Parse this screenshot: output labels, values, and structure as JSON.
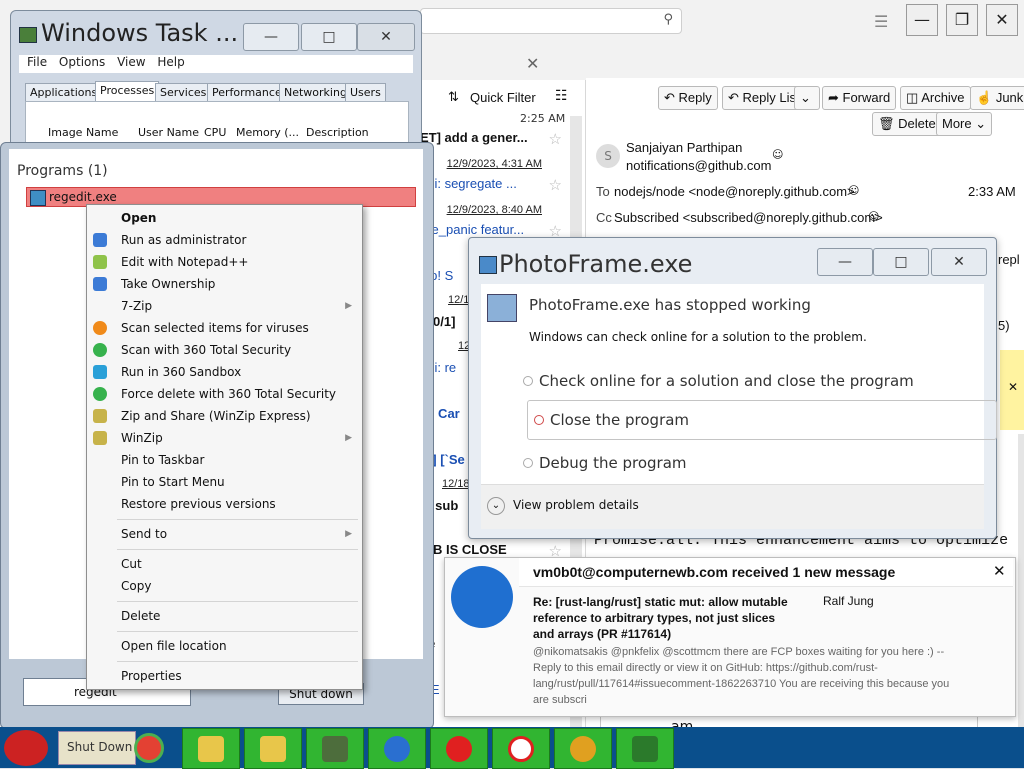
{
  "thunderbird": {
    "search_icon": "magnifier-icon",
    "time_partial": "2:25 AM",
    "quick_filter": "Quick Filter",
    "threads": [
      {
        "subject": "ET] add a gener...",
        "date": ""
      },
      {
        "subject": "",
        "date": "12/9/2023, 4:31 AM"
      },
      {
        "subject": "api: segregate ...",
        "date": ""
      },
      {
        "subject": "",
        "date": "12/9/2023, 8:40 AM"
      },
      {
        "subject": "ore_panic featur...",
        "date": ""
      },
      {
        "subject": "elp! S",
        "date": ""
      },
      {
        "subject": "",
        "date": "12/1"
      },
      {
        "subject": "H 0/1]",
        "date": ""
      },
      {
        "subject": "",
        "date": "12"
      },
      {
        "subject": "api: re",
        "date": ""
      },
      {
        "subject": "w] Car",
        "date": ""
      },
      {
        "subject": "rs] [`Se",
        "date": ""
      },
      {
        "subject": "",
        "date": "12/18"
      },
      {
        "subject": "id sub",
        "date": ""
      },
      {
        "subject": "N/B IS CLOSE",
        "date": ""
      },
      {
        "subject": "ro",
        "date": ""
      },
      {
        "subject": "de",
        "date": ""
      },
      {
        "subject": "e E",
        "date": ""
      }
    ],
    "buttons": {
      "reply": "Reply",
      "reply_list": "Reply List",
      "forward": "Forward",
      "archive": "Archive",
      "junk": "Junk",
      "delete": "Delete",
      "more": "More"
    },
    "sender_name": "Sanjaiyan Parthipan",
    "sender_email": "notifications@github.com",
    "to_label": "To",
    "to_value": "nodejs/node <node@noreply.github.com>",
    "time": "2:33 AM",
    "cc_label": "Cc",
    "cc_value": "Subscribed <subscribed@noreply.github.com>",
    "body_partial": "Promise.all. This enhancement aims to optimize the",
    "partial_right_1": "repl",
    "partial_right_2": "5)",
    "compose_placeholder": "am"
  },
  "task_manager": {
    "title": "Windows Task ...",
    "menu": [
      "File",
      "Options",
      "View",
      "Help"
    ],
    "tabs": [
      "Applications",
      "Processes",
      "Services",
      "Performance",
      "Networking",
      "Users"
    ],
    "active_tab": "Processes",
    "columns": [
      "Image Name",
      "User Name",
      "CPU",
      "Memory (...",
      "Description"
    ]
  },
  "start_menu": {
    "heading": "Programs (1)",
    "item": "regedit.exe",
    "search_value": "regedit",
    "shutdown": "Shut down"
  },
  "context_menu": {
    "items": [
      {
        "label": "Open",
        "bold": true
      },
      {
        "label": "Run as administrator",
        "icon": "shield-icon"
      },
      {
        "label": "Edit with Notepad++",
        "icon": "notepad-icon"
      },
      {
        "label": "Take Ownership",
        "icon": "shield-icon"
      },
      {
        "label": "7-Zip",
        "submenu": true
      },
      {
        "label": "Scan selected items for viruses",
        "icon": "antivirus-icon"
      },
      {
        "label": "Scan with 360 Total Security",
        "icon": "360-icon"
      },
      {
        "label": "Run in 360 Sandbox",
        "icon": "sandbox-icon"
      },
      {
        "label": "Force delete with 360 Total Security",
        "icon": "360-icon"
      },
      {
        "label": "Zip and Share (WinZip Express)",
        "icon": "winzip-icon"
      },
      {
        "label": "WinZip",
        "icon": "winzip-icon",
        "submenu": true
      },
      {
        "label": "Pin to Taskbar"
      },
      {
        "label": "Pin to Start Menu"
      },
      {
        "label": "Restore previous versions"
      },
      {
        "label": "Send to",
        "submenu": true
      },
      {
        "label": "Cut"
      },
      {
        "label": "Copy"
      },
      {
        "label": "Delete"
      },
      {
        "label": "Open file location"
      },
      {
        "label": "Properties"
      }
    ]
  },
  "photoframe": {
    "title": "PhotoFrame.exe",
    "heading": "PhotoFrame.exe has stopped working",
    "description": "Windows can check online for a solution to the problem.",
    "options": [
      "Check online for a solution and close the program",
      "Close the program",
      "Debug the program"
    ],
    "details": "View problem details"
  },
  "notification": {
    "title": "vm0b0t@computernewb.com received 1 new message",
    "subject": "Re: [rust-lang/rust] static mut: allow mutable reference to arbitrary types, not just slices and arrays (PR #117614)",
    "author": "Ralf Jung",
    "preview": "@nikomatsakis @pnkfelix @scottmcm there are FCP boxes waiting for you here :) -- Reply to this email directly or view it on GitHub: https://github.com/rust-lang/rust/pull/117614#issuecomment-1862263710 You are receiving this because you are subscri",
    "close": "✕"
  },
  "taskbar": {
    "start_partial": "Shut Down",
    "apps": [
      "santa-icon",
      "folder-icon",
      "chrome-icon",
      "warning-app-icon",
      "warning-app-icon",
      "monitor-icon",
      "thunderbird-icon",
      "opera-icon",
      "yandex-icon",
      "lock-app-icon",
      "tree-icon"
    ]
  }
}
